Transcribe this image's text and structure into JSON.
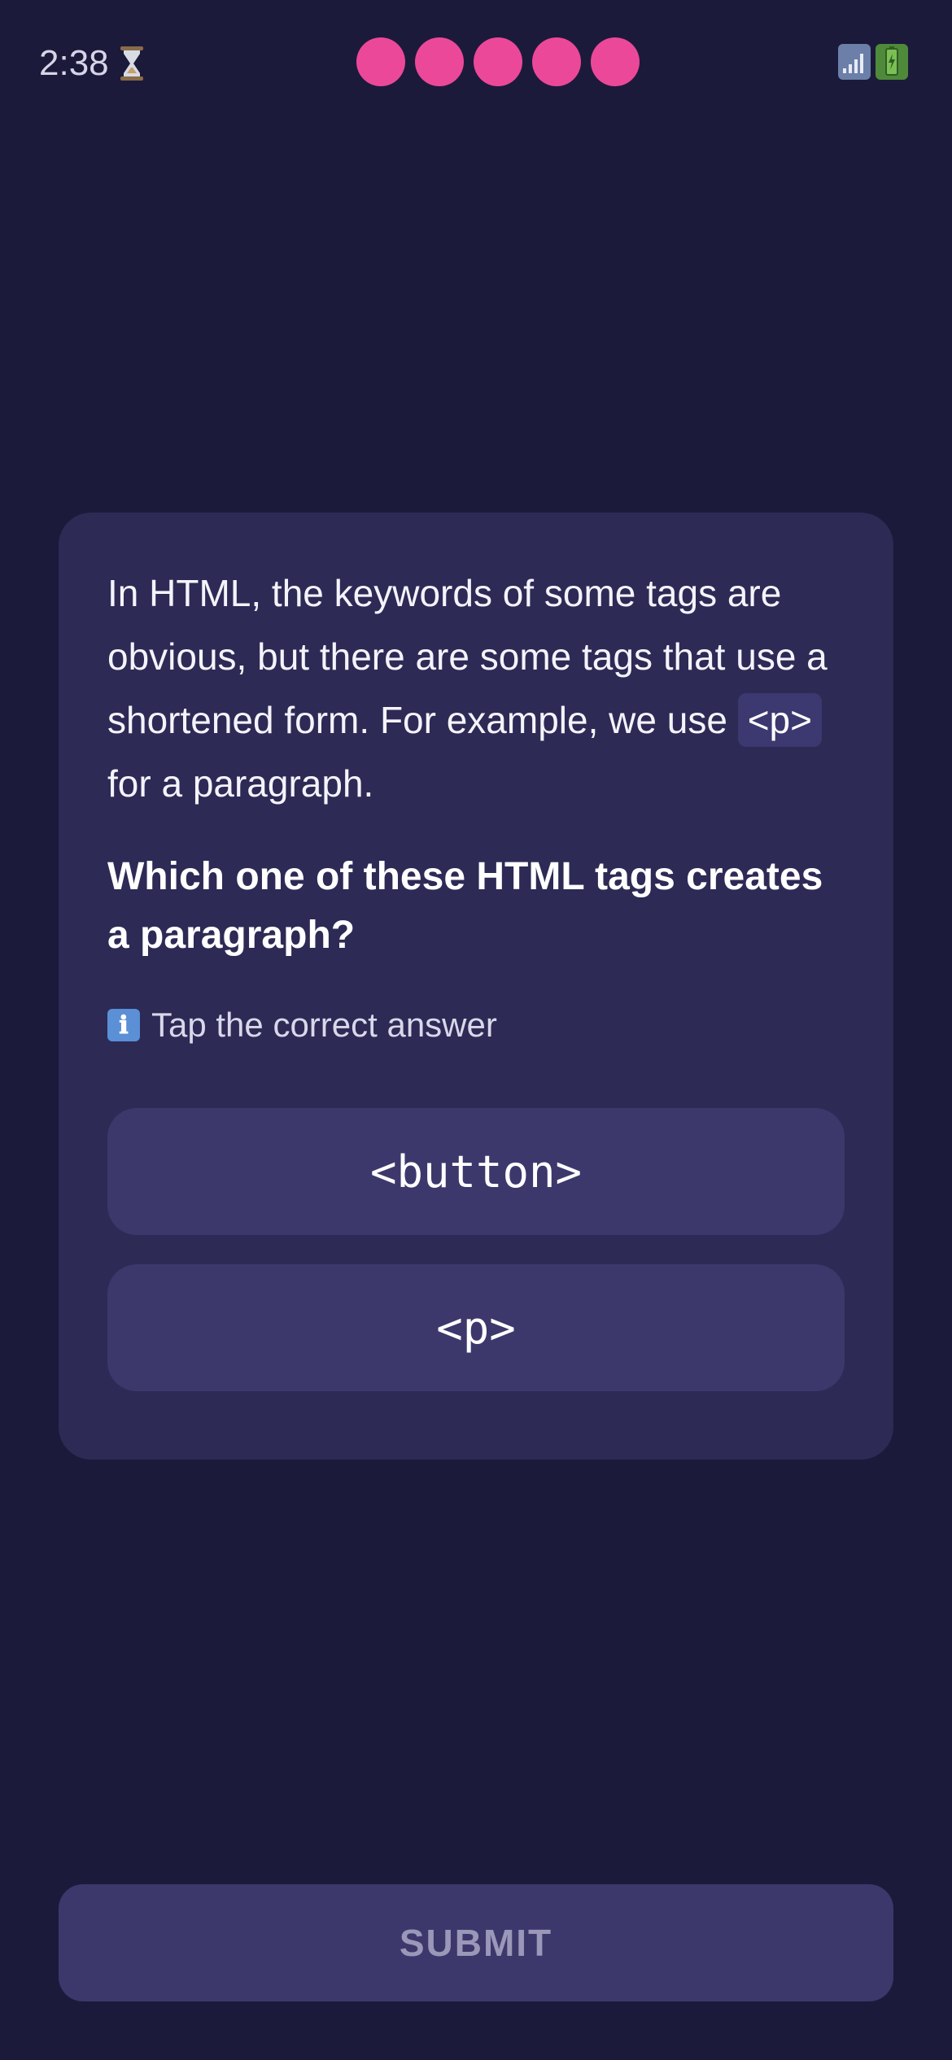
{
  "status_bar": {
    "time": "2:38",
    "lives_remaining": 5,
    "lives_color": "#ec4899"
  },
  "lesson": {
    "intro_before": "In HTML, the keywords of some tags are obvious, but there are some tags that use a shortened form. For example, we use ",
    "intro_code": "<p>",
    "intro_after": " for a paragraph.",
    "question": "Which one of these HTML tags creates a paragraph?",
    "hint_icon": "ℹ",
    "hint": "Tap the correct answer",
    "options": [
      {
        "label": "<button>"
      },
      {
        "label": "<p>"
      }
    ]
  },
  "submit": {
    "label": "SUBMIT"
  },
  "colors": {
    "background": "#1c1a3a",
    "card": "#2d2a55",
    "option": "#3c386c",
    "accent": "#ec4899"
  }
}
